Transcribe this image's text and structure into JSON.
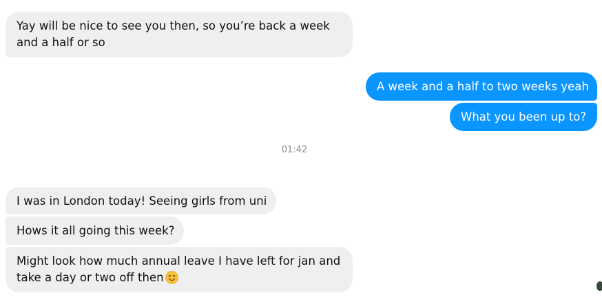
{
  "messages": [
    {
      "direction": "incoming",
      "lines": [
        "Yay will be nice to see you then, so you’re back a week",
        "and a half or so"
      ]
    },
    {
      "direction": "outgoing",
      "text": "A week and a half to two weeks yeah"
    },
    {
      "direction": "outgoing",
      "text": "What you been up to?"
    },
    {
      "direction": "incoming",
      "text": "I was in London today! Seeing girls from uni"
    },
    {
      "direction": "incoming",
      "text": "Hows it all going this week?"
    },
    {
      "direction": "incoming",
      "lines": [
        "Might look how much annual leave I have left for jan and",
        "take a day or two off then"
      ],
      "emoji": "smiling-face-emoji"
    }
  ],
  "timestamp": "01:42",
  "colors": {
    "incoming_bubble": "#efefef",
    "outgoing_bubble": "#0a95ff",
    "timestamp_text": "#8a8d91"
  }
}
